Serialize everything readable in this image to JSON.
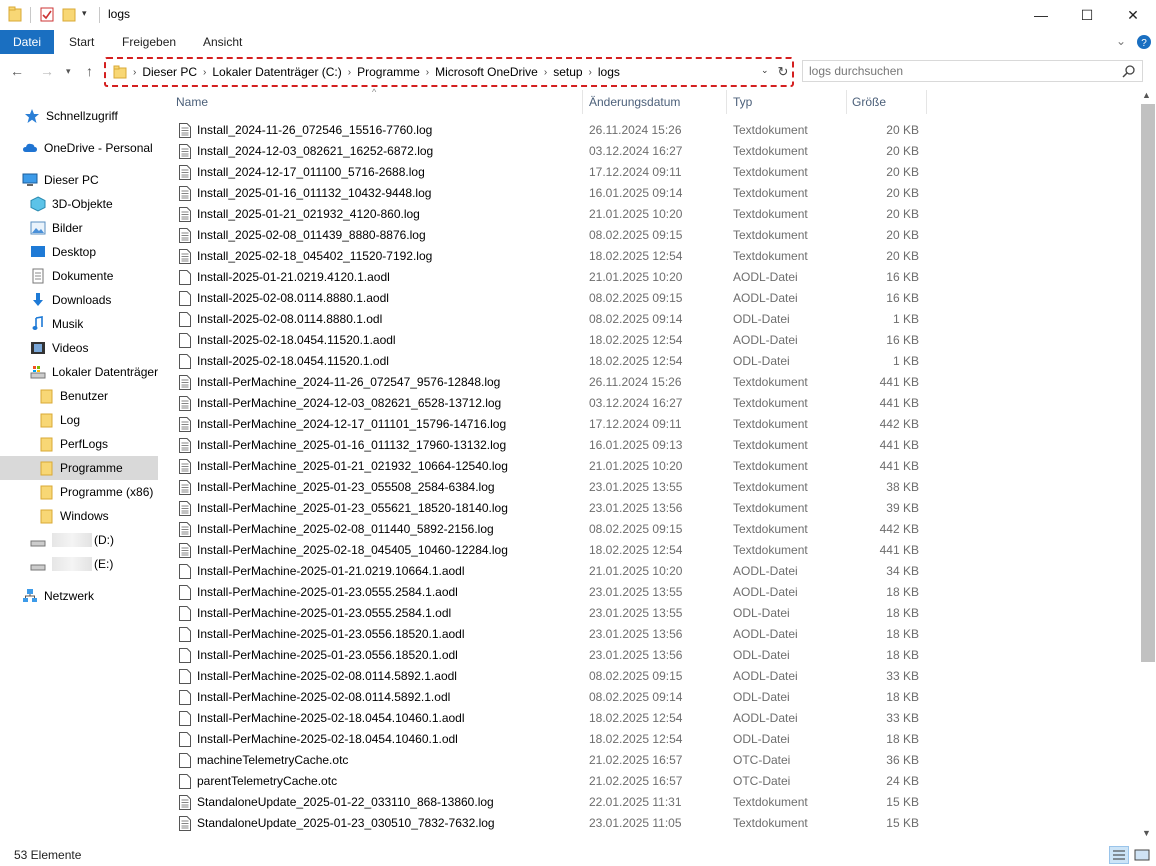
{
  "window": {
    "title": "logs",
    "minimize": "—",
    "maximize": "☐",
    "close": "✕"
  },
  "ribbon": {
    "file_tab": "Datei",
    "tabs": [
      "Start",
      "Freigeben",
      "Ansicht"
    ],
    "expand_icon": "chevron-down-icon",
    "help_icon": "help-icon"
  },
  "address": {
    "crumbs": [
      "Dieser PC",
      "Lokaler Datenträger (C:)",
      "Programme",
      "Microsoft OneDrive",
      "setup",
      "logs"
    ],
    "search_placeholder": "logs durchsuchen"
  },
  "sidebar": {
    "items": [
      {
        "label": "Schnellzugriff",
        "icon": "star-icon"
      },
      {
        "label": "OneDrive - Personal",
        "icon": "cloud-icon"
      },
      {
        "label": "Dieser PC",
        "icon": "computer-icon"
      },
      {
        "label": "3D-Objekte",
        "icon": "cube-icon"
      },
      {
        "label": "Bilder",
        "icon": "pictures-icon"
      },
      {
        "label": "Desktop",
        "icon": "desktop-icon"
      },
      {
        "label": "Dokumente",
        "icon": "documents-icon"
      },
      {
        "label": "Downloads",
        "icon": "download-icon"
      },
      {
        "label": "Musik",
        "icon": "music-icon"
      },
      {
        "label": "Videos",
        "icon": "video-icon"
      },
      {
        "label": "Lokaler Datenträger",
        "icon": "drive-icon"
      },
      {
        "label": "Benutzer",
        "icon": "folder-icon"
      },
      {
        "label": "Log",
        "icon": "folder-icon"
      },
      {
        "label": "PerfLogs",
        "icon": "folder-icon"
      },
      {
        "label": "Programme",
        "icon": "folder-icon"
      },
      {
        "label": "Programme (x86)",
        "icon": "folder-icon"
      },
      {
        "label": "Windows",
        "icon": "folder-icon"
      },
      {
        "label": "(D:)",
        "icon": "drive-icon"
      },
      {
        "label": "(E:)",
        "icon": "drive-icon"
      },
      {
        "label": "Netzwerk",
        "icon": "network-icon"
      }
    ]
  },
  "columns": {
    "name": "Name",
    "date": "Änderungsdatum",
    "type": "Typ",
    "size": "Größe"
  },
  "files": [
    {
      "name": "Install_2024-11-26_072546_15516-7760.log",
      "date": "26.11.2024 15:26",
      "type": "Textdokument",
      "size": "20 KB",
      "icon": "text-file-icon"
    },
    {
      "name": "Install_2024-12-03_082621_16252-6872.log",
      "date": "03.12.2024 16:27",
      "type": "Textdokument",
      "size": "20 KB",
      "icon": "text-file-icon"
    },
    {
      "name": "Install_2024-12-17_011100_5716-2688.log",
      "date": "17.12.2024 09:11",
      "type": "Textdokument",
      "size": "20 KB",
      "icon": "text-file-icon"
    },
    {
      "name": "Install_2025-01-16_011132_10432-9448.log",
      "date": "16.01.2025 09:14",
      "type": "Textdokument",
      "size": "20 KB",
      "icon": "text-file-icon"
    },
    {
      "name": "Install_2025-01-21_021932_4120-860.log",
      "date": "21.01.2025 10:20",
      "type": "Textdokument",
      "size": "20 KB",
      "icon": "text-file-icon"
    },
    {
      "name": "Install_2025-02-08_011439_8880-8876.log",
      "date": "08.02.2025 09:15",
      "type": "Textdokument",
      "size": "20 KB",
      "icon": "text-file-icon"
    },
    {
      "name": "Install_2025-02-18_045402_11520-7192.log",
      "date": "18.02.2025 12:54",
      "type": "Textdokument",
      "size": "20 KB",
      "icon": "text-file-icon"
    },
    {
      "name": "Install-2025-01-21.0219.4120.1.aodl",
      "date": "21.01.2025 10:20",
      "type": "AODL-Datei",
      "size": "16 KB",
      "icon": "blank-file-icon"
    },
    {
      "name": "Install-2025-02-08.0114.8880.1.aodl",
      "date": "08.02.2025 09:15",
      "type": "AODL-Datei",
      "size": "16 KB",
      "icon": "blank-file-icon"
    },
    {
      "name": "Install-2025-02-08.0114.8880.1.odl",
      "date": "08.02.2025 09:14",
      "type": "ODL-Datei",
      "size": "1 KB",
      "icon": "blank-file-icon"
    },
    {
      "name": "Install-2025-02-18.0454.11520.1.aodl",
      "date": "18.02.2025 12:54",
      "type": "AODL-Datei",
      "size": "16 KB",
      "icon": "blank-file-icon"
    },
    {
      "name": "Install-2025-02-18.0454.11520.1.odl",
      "date": "18.02.2025 12:54",
      "type": "ODL-Datei",
      "size": "1 KB",
      "icon": "blank-file-icon"
    },
    {
      "name": "Install-PerMachine_2024-11-26_072547_9576-12848.log",
      "date": "26.11.2024 15:26",
      "type": "Textdokument",
      "size": "441 KB",
      "icon": "text-file-icon"
    },
    {
      "name": "Install-PerMachine_2024-12-03_082621_6528-13712.log",
      "date": "03.12.2024 16:27",
      "type": "Textdokument",
      "size": "441 KB",
      "icon": "text-file-icon"
    },
    {
      "name": "Install-PerMachine_2024-12-17_011101_15796-14716.log",
      "date": "17.12.2024 09:11",
      "type": "Textdokument",
      "size": "442 KB",
      "icon": "text-file-icon"
    },
    {
      "name": "Install-PerMachine_2025-01-16_011132_17960-13132.log",
      "date": "16.01.2025 09:13",
      "type": "Textdokument",
      "size": "441 KB",
      "icon": "text-file-icon"
    },
    {
      "name": "Install-PerMachine_2025-01-21_021932_10664-12540.log",
      "date": "21.01.2025 10:20",
      "type": "Textdokument",
      "size": "441 KB",
      "icon": "text-file-icon"
    },
    {
      "name": "Install-PerMachine_2025-01-23_055508_2584-6384.log",
      "date": "23.01.2025 13:55",
      "type": "Textdokument",
      "size": "38 KB",
      "icon": "text-file-icon"
    },
    {
      "name": "Install-PerMachine_2025-01-23_055621_18520-18140.log",
      "date": "23.01.2025 13:56",
      "type": "Textdokument",
      "size": "39 KB",
      "icon": "text-file-icon"
    },
    {
      "name": "Install-PerMachine_2025-02-08_011440_5892-2156.log",
      "date": "08.02.2025 09:15",
      "type": "Textdokument",
      "size": "442 KB",
      "icon": "text-file-icon"
    },
    {
      "name": "Install-PerMachine_2025-02-18_045405_10460-12284.log",
      "date": "18.02.2025 12:54",
      "type": "Textdokument",
      "size": "441 KB",
      "icon": "text-file-icon"
    },
    {
      "name": "Install-PerMachine-2025-01-21.0219.10664.1.aodl",
      "date": "21.01.2025 10:20",
      "type": "AODL-Datei",
      "size": "34 KB",
      "icon": "blank-file-icon"
    },
    {
      "name": "Install-PerMachine-2025-01-23.0555.2584.1.aodl",
      "date": "23.01.2025 13:55",
      "type": "AODL-Datei",
      "size": "18 KB",
      "icon": "blank-file-icon"
    },
    {
      "name": "Install-PerMachine-2025-01-23.0555.2584.1.odl",
      "date": "23.01.2025 13:55",
      "type": "ODL-Datei",
      "size": "18 KB",
      "icon": "blank-file-icon"
    },
    {
      "name": "Install-PerMachine-2025-01-23.0556.18520.1.aodl",
      "date": "23.01.2025 13:56",
      "type": "AODL-Datei",
      "size": "18 KB",
      "icon": "blank-file-icon"
    },
    {
      "name": "Install-PerMachine-2025-01-23.0556.18520.1.odl",
      "date": "23.01.2025 13:56",
      "type": "ODL-Datei",
      "size": "18 KB",
      "icon": "blank-file-icon"
    },
    {
      "name": "Install-PerMachine-2025-02-08.0114.5892.1.aodl",
      "date": "08.02.2025 09:15",
      "type": "AODL-Datei",
      "size": "33 KB",
      "icon": "blank-file-icon"
    },
    {
      "name": "Install-PerMachine-2025-02-08.0114.5892.1.odl",
      "date": "08.02.2025 09:14",
      "type": "ODL-Datei",
      "size": "18 KB",
      "icon": "blank-file-icon"
    },
    {
      "name": "Install-PerMachine-2025-02-18.0454.10460.1.aodl",
      "date": "18.02.2025 12:54",
      "type": "AODL-Datei",
      "size": "33 KB",
      "icon": "blank-file-icon"
    },
    {
      "name": "Install-PerMachine-2025-02-18.0454.10460.1.odl",
      "date": "18.02.2025 12:54",
      "type": "ODL-Datei",
      "size": "18 KB",
      "icon": "blank-file-icon"
    },
    {
      "name": "machineTelemetryCache.otc",
      "date": "21.02.2025 16:57",
      "type": "OTC-Datei",
      "size": "36 KB",
      "icon": "blank-file-icon"
    },
    {
      "name": "parentTelemetryCache.otc",
      "date": "21.02.2025 16:57",
      "type": "OTC-Datei",
      "size": "24 KB",
      "icon": "blank-file-icon"
    },
    {
      "name": "StandaloneUpdate_2025-01-22_033110_868-13860.log",
      "date": "22.01.2025 11:31",
      "type": "Textdokument",
      "size": "15 KB",
      "icon": "text-file-icon"
    },
    {
      "name": "StandaloneUpdate_2025-01-23_030510_7832-7632.log",
      "date": "23.01.2025 11:05",
      "type": "Textdokument",
      "size": "15 KB",
      "icon": "text-file-icon"
    }
  ],
  "status": {
    "count": "53 Elemente"
  }
}
